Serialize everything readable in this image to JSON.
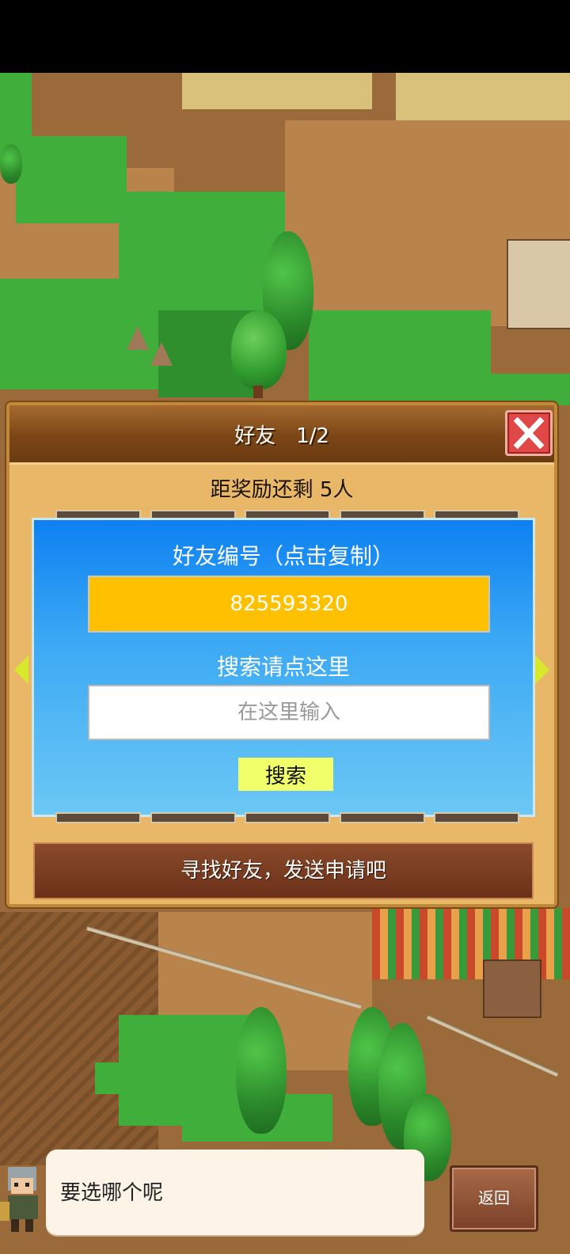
{
  "dialog": {
    "title": "好友　1/2",
    "close_icon": "close-x-icon",
    "reward_text": "距奖励还剩 5人",
    "friend_id_label": "好友编号（点击复制）",
    "friend_id_value": "825593320",
    "search_hint": "搜索请点这里",
    "search_placeholder": "在这里输入",
    "search_button": "搜索",
    "find_friends_label": "寻找好友，发送申请吧",
    "prev_icon": "arrow-left-icon",
    "next_icon": "arrow-right-icon"
  },
  "bottom": {
    "speech_text": "要选哪个呢",
    "back_label": "返回"
  },
  "colors": {
    "panel_blue": "#3aa8f4",
    "id_yellow": "#ffc000",
    "search_button": "#f0ff6a",
    "close_red": "#e04848",
    "header_brown": "#7b4616",
    "grass": "#3fae3a"
  }
}
